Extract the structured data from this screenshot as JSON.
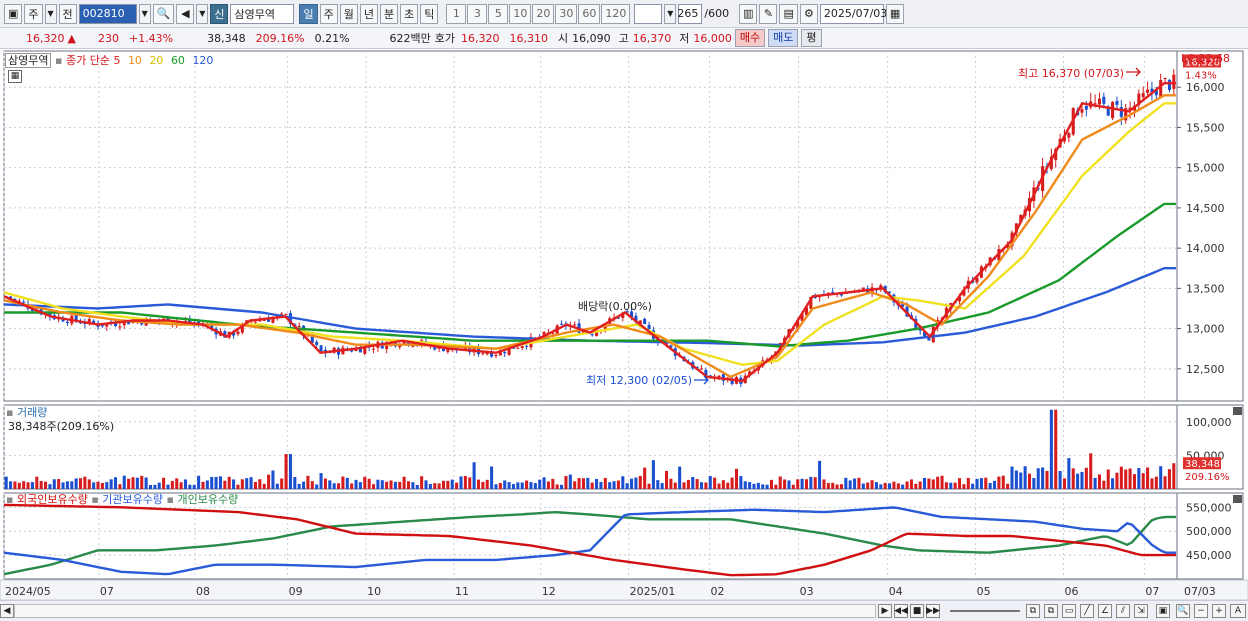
{
  "toolbar": {
    "period_selector": "주",
    "prev_label": "전",
    "stock_code": "002810",
    "new_badge": "신",
    "stock_name": "삼영무역",
    "period_tabs": [
      "일",
      "주",
      "월",
      "년",
      "분",
      "초",
      "틱"
    ],
    "interval_buttons": [
      "1",
      "3",
      "5",
      "10",
      "20",
      "30",
      "60",
      "120"
    ],
    "bar_count": "265",
    "bar_total": "/600",
    "date": "2025/07/03"
  },
  "quote": {
    "price": "16,320",
    "change_arrow": "▲",
    "change": "230",
    "change_pct": "+1.43%",
    "volume": "38,348",
    "volume_ratio": "209.16%",
    "turnover": "0.21%",
    "trade_value": "622백만",
    "bid_label": "호가",
    "ask_price": "16,320",
    "bid_price": "16,310",
    "open_label": "시",
    "open": "16,090",
    "high_label": "고",
    "high": "16,370",
    "low_label": "저",
    "low": "16,000",
    "buy_button": "매수",
    "sell_button": "매도",
    "eval_button": "평"
  },
  "price_panel": {
    "name": "삼영무역",
    "legend_prefix": "종가 단순",
    "ma_periods": [
      "5",
      "10",
      "20",
      "60",
      "120"
    ],
    "ma_colors": [
      "#e02020",
      "#f08a1a",
      "#f0e020",
      "#1a9a2a",
      "#2a5ad8"
    ],
    "lc_label": "LC:32,68",
    "current_price_tag": "16,320",
    "current_pct_tag": "1.43%",
    "high_annotation": "최고 16,370 (07/03)",
    "low_annotation": "최저 12,300 (02/05)",
    "dividend_annotation": "배당락(0.00%)"
  },
  "volume_panel": {
    "title": "거래량",
    "subtitle": "38,348주(209.16%)",
    "current_tag": "38,348",
    "current_pct_tag": "209.16%"
  },
  "holdings_panel": {
    "series": [
      "외국인보유수량",
      "기관보유수량",
      "개인보유수량"
    ],
    "colors": [
      "#d01010",
      "#2a5ad8",
      "#2a8a4a"
    ]
  },
  "x_axis_labels": [
    "2024/05",
    "07",
    "08",
    "09",
    "10",
    "11",
    "12",
    "2025/01",
    "02",
    "03",
    "04",
    "05",
    "06",
    "07",
    "07/03"
  ],
  "chart_data": {
    "type": "candlestick",
    "price_axis": {
      "ticks": [
        12500,
        13000,
        13500,
        14000,
        14500,
        15000,
        15500,
        16000
      ],
      "range": [
        12100,
        16450
      ]
    },
    "volume_axis": {
      "ticks": [
        50000,
        100000
      ],
      "range": [
        0,
        125000
      ]
    },
    "holdings_axis": {
      "ticks": [
        450000,
        500000,
        550000
      ],
      "range": [
        400000,
        580000
      ]
    },
    "ma_anchors": {
      "ma5": [
        [
          0,
          13400
        ],
        [
          0.04,
          13150
        ],
        [
          0.08,
          13050
        ],
        [
          0.11,
          13100
        ],
        [
          0.14,
          13100
        ],
        [
          0.17,
          13050
        ],
        [
          0.19,
          12900
        ],
        [
          0.21,
          13100
        ],
        [
          0.24,
          13150
        ],
        [
          0.27,
          12700
        ],
        [
          0.3,
          12750
        ],
        [
          0.34,
          12850
        ],
        [
          0.38,
          12750
        ],
        [
          0.42,
          12700
        ],
        [
          0.46,
          12900
        ],
        [
          0.48,
          13050
        ],
        [
          0.5,
          12950
        ],
        [
          0.53,
          13200
        ],
        [
          0.56,
          12850
        ],
        [
          0.6,
          12400
        ],
        [
          0.63,
          12350
        ],
        [
          0.66,
          12700
        ],
        [
          0.69,
          13400
        ],
        [
          0.72,
          13450
        ],
        [
          0.75,
          13500
        ],
        [
          0.77,
          13200
        ],
        [
          0.79,
          12900
        ],
        [
          0.82,
          13500
        ],
        [
          0.86,
          14100
        ],
        [
          0.89,
          15000
        ],
        [
          0.92,
          15800
        ],
        [
          0.96,
          15700
        ],
        [
          0.99,
          16050
        ]
      ],
      "ma10": [
        [
          0,
          13350
        ],
        [
          0.05,
          13200
        ],
        [
          0.1,
          13100
        ],
        [
          0.15,
          13050
        ],
        [
          0.2,
          13050
        ],
        [
          0.25,
          12950
        ],
        [
          0.3,
          12800
        ],
        [
          0.35,
          12800
        ],
        [
          0.42,
          12750
        ],
        [
          0.48,
          12950
        ],
        [
          0.52,
          13050
        ],
        [
          0.56,
          12900
        ],
        [
          0.62,
          12400
        ],
        [
          0.66,
          12650
        ],
        [
          0.69,
          13250
        ],
        [
          0.74,
          13450
        ],
        [
          0.77,
          13300
        ],
        [
          0.8,
          13050
        ],
        [
          0.84,
          13650
        ],
        [
          0.88,
          14450
        ],
        [
          0.92,
          15350
        ],
        [
          0.96,
          15650
        ],
        [
          0.99,
          15900
        ]
      ],
      "ma20": [
        [
          0,
          13450
        ],
        [
          0.05,
          13250
        ],
        [
          0.1,
          13150
        ],
        [
          0.16,
          13050
        ],
        [
          0.22,
          13050
        ],
        [
          0.28,
          12900
        ],
        [
          0.34,
          12850
        ],
        [
          0.42,
          12750
        ],
        [
          0.5,
          12950
        ],
        [
          0.54,
          13050
        ],
        [
          0.58,
          12750
        ],
        [
          0.63,
          12550
        ],
        [
          0.66,
          12600
        ],
        [
          0.7,
          13050
        ],
        [
          0.75,
          13400
        ],
        [
          0.78,
          13350
        ],
        [
          0.82,
          13250
        ],
        [
          0.87,
          13900
        ],
        [
          0.92,
          14900
        ],
        [
          0.96,
          15450
        ],
        [
          0.99,
          15800
        ]
      ],
      "ma60": [
        [
          0,
          13200
        ],
        [
          0.1,
          13200
        ],
        [
          0.2,
          13050
        ],
        [
          0.3,
          12950
        ],
        [
          0.4,
          12850
        ],
        [
          0.5,
          12850
        ],
        [
          0.6,
          12850
        ],
        [
          0.66,
          12780
        ],
        [
          0.72,
          12850
        ],
        [
          0.78,
          13000
        ],
        [
          0.84,
          13200
        ],
        [
          0.9,
          13600
        ],
        [
          0.95,
          14150
        ],
        [
          0.99,
          14550
        ]
      ],
      "ma120": [
        [
          0,
          13300
        ],
        [
          0.08,
          13250
        ],
        [
          0.14,
          13300
        ],
        [
          0.22,
          13200
        ],
        [
          0.3,
          13000
        ],
        [
          0.4,
          12900
        ],
        [
          0.5,
          12850
        ],
        [
          0.6,
          12820
        ],
        [
          0.68,
          12790
        ],
        [
          0.75,
          12830
        ],
        [
          0.82,
          12950
        ],
        [
          0.88,
          13150
        ],
        [
          0.94,
          13450
        ],
        [
          0.99,
          13750
        ]
      ]
    },
    "holdings_anchors": {
      "foreign": [
        [
          0,
          555000
        ],
        [
          0.1,
          550000
        ],
        [
          0.2,
          540000
        ],
        [
          0.25,
          525000
        ],
        [
          0.3,
          495000
        ],
        [
          0.38,
          490000
        ],
        [
          0.45,
          470000
        ],
        [
          0.52,
          440000
        ],
        [
          0.58,
          420000
        ],
        [
          0.62,
          408000
        ],
        [
          0.66,
          410000
        ],
        [
          0.7,
          430000
        ],
        [
          0.74,
          460000
        ],
        [
          0.77,
          495000
        ],
        [
          0.82,
          490000
        ],
        [
          0.86,
          490000
        ],
        [
          0.9,
          480000
        ],
        [
          0.94,
          470000
        ],
        [
          0.97,
          450000
        ],
        [
          0.99,
          450000
        ]
      ],
      "institution": [
        [
          0,
          455000
        ],
        [
          0.05,
          440000
        ],
        [
          0.1,
          415000
        ],
        [
          0.14,
          410000
        ],
        [
          0.18,
          430000
        ],
        [
          0.23,
          430000
        ],
        [
          0.3,
          425000
        ],
        [
          0.36,
          440000
        ],
        [
          0.42,
          440000
        ],
        [
          0.47,
          450000
        ],
        [
          0.5,
          460000
        ],
        [
          0.53,
          535000
        ],
        [
          0.58,
          540000
        ],
        [
          0.64,
          545000
        ],
        [
          0.7,
          540000
        ],
        [
          0.76,
          550000
        ],
        [
          0.8,
          530000
        ],
        [
          0.84,
          525000
        ],
        [
          0.88,
          520000
        ],
        [
          0.92,
          505000
        ],
        [
          0.95,
          500000
        ],
        [
          0.96,
          520000
        ],
        [
          0.98,
          470000
        ],
        [
          0.99,
          455000
        ]
      ],
      "individual": [
        [
          0,
          410000
        ],
        [
          0.04,
          430000
        ],
        [
          0.08,
          460000
        ],
        [
          0.13,
          460000
        ],
        [
          0.18,
          470000
        ],
        [
          0.23,
          485000
        ],
        [
          0.28,
          510000
        ],
        [
          0.34,
          520000
        ],
        [
          0.4,
          530000
        ],
        [
          0.44,
          535000
        ],
        [
          0.47,
          540000
        ],
        [
          0.5,
          535000
        ],
        [
          0.55,
          525000
        ],
        [
          0.62,
          525000
        ],
        [
          0.66,
          510000
        ],
        [
          0.7,
          495000
        ],
        [
          0.75,
          470000
        ],
        [
          0.78,
          460000
        ],
        [
          0.84,
          455000
        ],
        [
          0.9,
          470000
        ],
        [
          0.94,
          490000
        ],
        [
          0.96,
          470000
        ],
        [
          0.98,
          525000
        ],
        [
          0.99,
          530000
        ]
      ]
    }
  }
}
